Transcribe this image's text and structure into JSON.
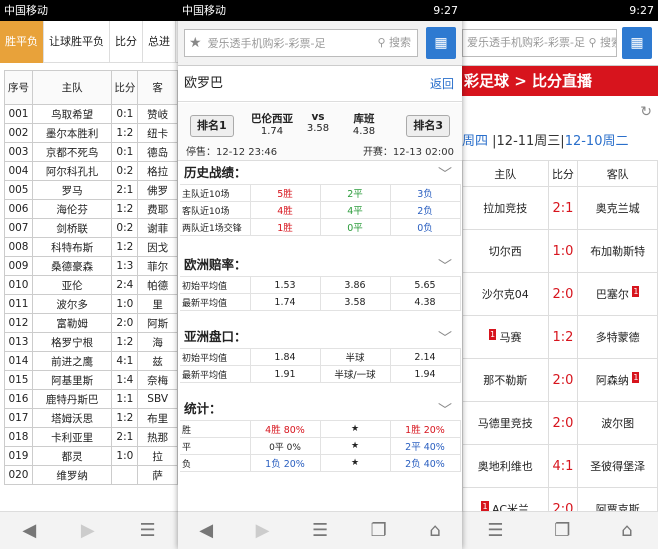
{
  "status": {
    "carrier": "中国移动",
    "time": "9:27"
  },
  "left": {
    "tabs": [
      "胜平负",
      "让球胜平负",
      "比分",
      "总进"
    ],
    "headers": [
      "序号",
      "主队",
      "比分",
      "客"
    ],
    "rows": [
      [
        "001",
        "鸟取希望",
        "0:1",
        "赞岐"
      ],
      [
        "002",
        "墨尔本胜利",
        "1:2",
        "纽卡"
      ],
      [
        "003",
        "京都不死鸟",
        "0:1",
        "德岛"
      ],
      [
        "004",
        "阿尔科孔扎",
        "0:2",
        "格拉"
      ],
      [
        "005",
        "罗马",
        "2:1",
        "佛罗"
      ],
      [
        "006",
        "海伦芬",
        "1:2",
        "费耶"
      ],
      [
        "007",
        "剑桥联",
        "0:2",
        "谢菲"
      ],
      [
        "008",
        "科特布斯",
        "1:2",
        "因戈"
      ],
      [
        "009",
        "桑德豪森",
        "1:3",
        "菲尔"
      ],
      [
        "010",
        "亚伦",
        "2:4",
        "帕德"
      ],
      [
        "011",
        "波尔多",
        "1:0",
        "里"
      ],
      [
        "012",
        "富勒姆",
        "2:0",
        "阿斯"
      ],
      [
        "013",
        "格罗宁根",
        "1:2",
        "海"
      ],
      [
        "014",
        "前进之鹰",
        "4:1",
        "兹"
      ],
      [
        "015",
        "阿基里斯",
        "1:4",
        "奈梅"
      ],
      [
        "016",
        "鹿特丹斯巴",
        "1:1",
        "SBV"
      ],
      [
        "017",
        "塔姆沃思",
        "1:2",
        "布里"
      ],
      [
        "018",
        "卡利亚里",
        "2:1",
        "热那"
      ],
      [
        "019",
        "都灵",
        "1:0",
        "拉"
      ],
      [
        "020",
        "维罗纳",
        "",
        "萨"
      ]
    ]
  },
  "middle": {
    "search_placeholder": "爱乐透手机购彩-彩票-足",
    "search_label": "搜索",
    "league": "欧罗巴",
    "back": "返回",
    "rank_home": "排名1",
    "rank_away": "排名3",
    "home": {
      "name": "巴伦西亚",
      "odds": "1.74"
    },
    "vs": "vs",
    "draw_odds": "3.58",
    "away": {
      "name": "库班",
      "odds": "4.38"
    },
    "stop": "停售：12-12 23:46",
    "open": "开赛：12-13 02:00",
    "history": {
      "title": "历史战绩：",
      "rows": [
        [
          "主队近10场",
          "5胜",
          "2平",
          "3负"
        ],
        [
          "客队近10场",
          "4胜",
          "4平",
          "2负"
        ],
        [
          "两队近1场交锋",
          "1胜",
          "0平",
          "0负"
        ]
      ]
    },
    "euro": {
      "title": "欧洲赔率：",
      "rows": [
        [
          "初始平均值",
          "1.53",
          "3.86",
          "5.65"
        ],
        [
          "最新平均值",
          "1.74",
          "3.58",
          "4.38"
        ]
      ]
    },
    "asia": {
      "title": "亚洲盘口：",
      "rows": [
        [
          "初始平均值",
          "1.84",
          "半球",
          "2.14"
        ],
        [
          "最新平均值",
          "1.91",
          "半球/一球",
          "1.94"
        ]
      ]
    },
    "stats": {
      "title": "统计：",
      "rows": [
        [
          "胜",
          "4胜 80%",
          "★",
          "1胜 20%"
        ],
        [
          "平",
          "0平 0%",
          "★",
          "2平 40%"
        ],
        [
          "负",
          "1负 20%",
          "★",
          "2负 40%"
        ]
      ]
    }
  },
  "right": {
    "search_placeholder": "爱乐透手机购彩-彩票-足",
    "search_label": "搜索",
    "header": "彩足球 > 比分直播",
    "date_a": "周四",
    "date_sep1": " |12-11周三|",
    "date_b": "12-10周二",
    "headers": [
      "主队",
      "比分",
      "客队"
    ],
    "rows": [
      {
        "home": "拉加竞技",
        "score": "2:1",
        "away": "奥克兰城",
        "hc": "",
        "ac": ""
      },
      {
        "home": "切尔西",
        "score": "1:0",
        "away": "布加勒斯特",
        "hc": "",
        "ac": ""
      },
      {
        "home": "沙尔克04",
        "score": "2:0",
        "away": "巴塞尔",
        "hc": "",
        "ac": "1"
      },
      {
        "home": "马赛",
        "score": "1:2",
        "away": "多特蒙德",
        "hc": "1",
        "ac": ""
      },
      {
        "home": "那不勒斯",
        "score": "2:0",
        "away": "阿森纳",
        "hc": "",
        "ac": "1"
      },
      {
        "home": "马德里竞技",
        "score": "2:0",
        "away": "波尔图",
        "hc": "",
        "ac": ""
      },
      {
        "home": "奥地利维也",
        "score": "4:1",
        "away": "圣彼得堡泽",
        "hc": "",
        "ac": ""
      },
      {
        "home": "AC米兰",
        "score": "2:0",
        "away": "阿贾克斯",
        "hc": "1",
        "ac": ""
      }
    ]
  }
}
